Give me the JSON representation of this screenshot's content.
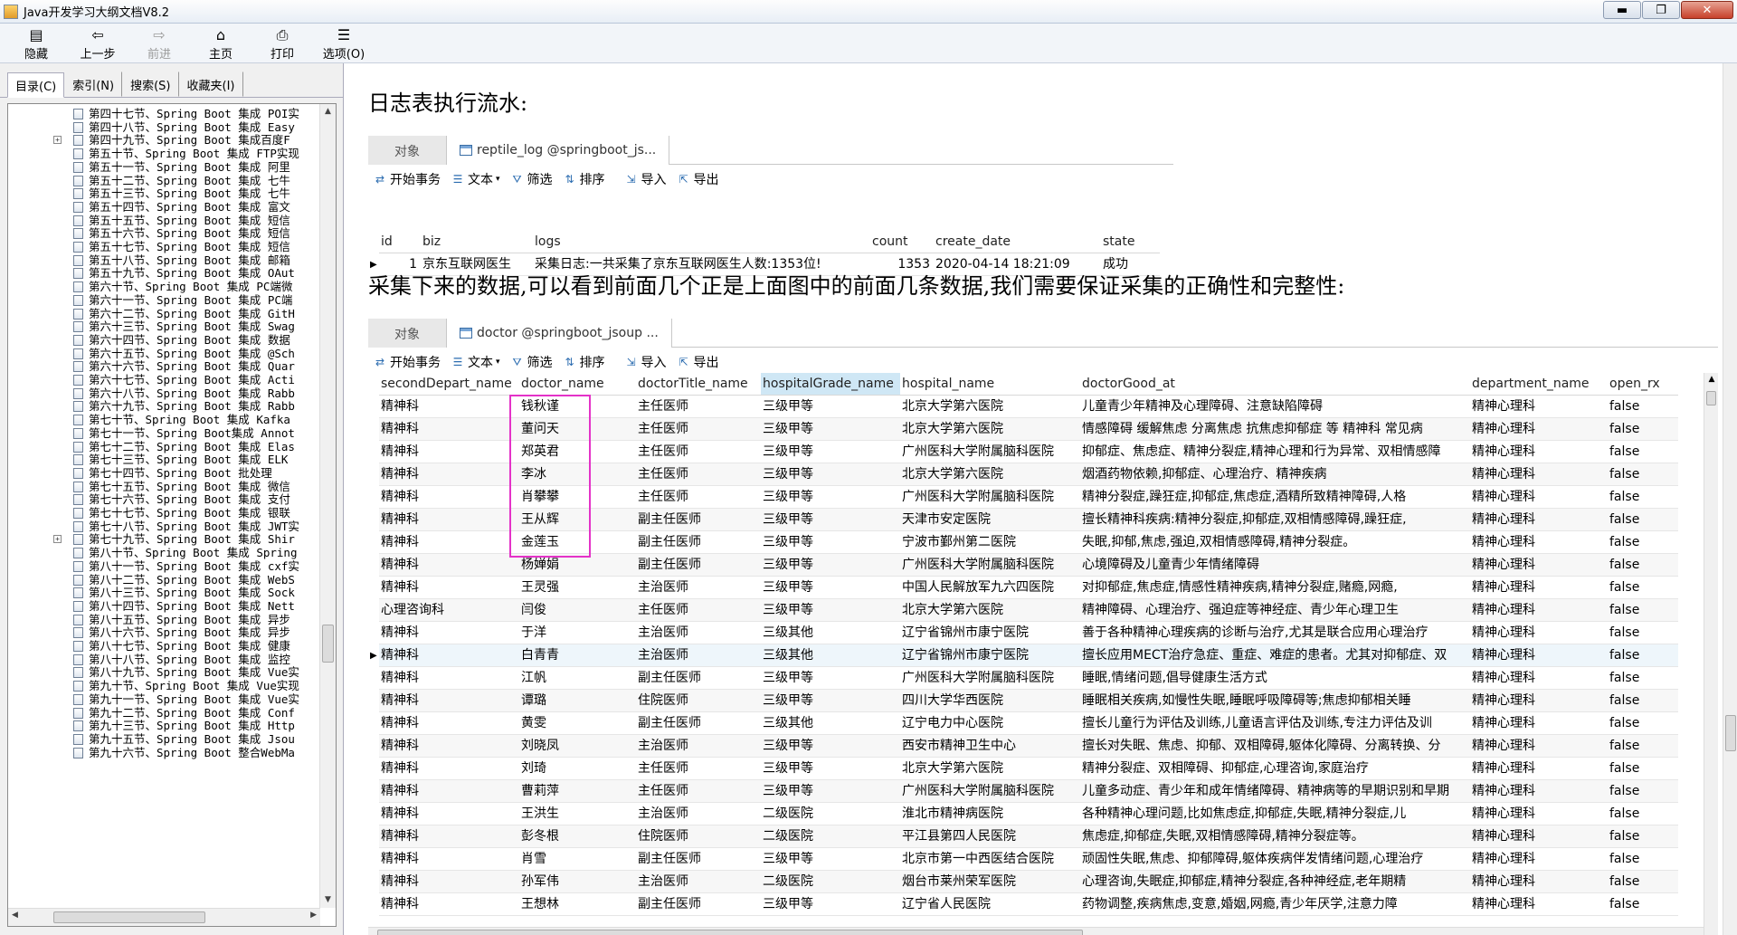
{
  "window": {
    "title": "Java开发学习大纲文档V8.2",
    "buttons": {
      "minimize": "▬",
      "maximize": "❐",
      "close": "✕"
    }
  },
  "toolbar": [
    {
      "icon": "hide-icon",
      "glyph": "▤",
      "label": "隐藏",
      "enabled": true
    },
    {
      "icon": "back-icon",
      "glyph": "⇦",
      "label": "上一步",
      "enabled": true
    },
    {
      "icon": "forward-icon",
      "glyph": "⇨",
      "label": "前进",
      "enabled": false
    },
    {
      "icon": "home-icon",
      "glyph": "⌂",
      "label": "主页",
      "enabled": true
    },
    {
      "icon": "print-icon",
      "glyph": "⎙",
      "label": "打印",
      "enabled": true
    },
    {
      "icon": "options-icon",
      "glyph": "☰",
      "label": "选项(O)",
      "enabled": true
    }
  ],
  "left_tabs": [
    "目录(C)",
    "索引(N)",
    "搜索(S)",
    "收藏夹(I)"
  ],
  "tree_items": [
    {
      "text": "第四十七节、Spring Boot 集成 POI实",
      "plus": false
    },
    {
      "text": "第四十八节、Spring Boot 集成 Easy",
      "plus": false
    },
    {
      "text": "第四十九节、Spring Boot 集成百度F",
      "plus": true
    },
    {
      "text": "第五十节、Spring Boot 集成 FTP实现",
      "plus": false
    },
    {
      "text": "第五十一节、Spring Boot 集成 阿里",
      "plus": false
    },
    {
      "text": "第五十二节、Spring Boot 集成 七牛",
      "plus": false
    },
    {
      "text": "第五十三节、Spring Boot 集成 七牛",
      "plus": false
    },
    {
      "text": "第五十四节、Spring Boot 集成 富文",
      "plus": false
    },
    {
      "text": "第五十五节、Spring Boot 集成 短信",
      "plus": false
    },
    {
      "text": "第五十六节、Spring Boot 集成 短信",
      "plus": false
    },
    {
      "text": "第五十七节、Spring Boot 集成 短信",
      "plus": false
    },
    {
      "text": "第五十八节、Spring Boot 集成 邮箱",
      "plus": false
    },
    {
      "text": "第五十九节、Spring Boot 集成 OAut",
      "plus": false
    },
    {
      "text": "第六十节、Spring Boot 集成 PC端微",
      "plus": false
    },
    {
      "text": "第六十一节、Spring Boot 集成 PC端",
      "plus": false
    },
    {
      "text": "第六十二节、Spring Boot 集成 GitH",
      "plus": false
    },
    {
      "text": "第六十三节、Spring Boot 集成 Swag",
      "plus": false
    },
    {
      "text": "第六十四节、Spring Boot 集成 数据",
      "plus": false
    },
    {
      "text": "第六十五节、Spring Boot 集成 @Sch",
      "plus": false
    },
    {
      "text": "第六十六节、Spring Boot 集成 Quar",
      "plus": false
    },
    {
      "text": "第六十七节、Spring Boot 集成 Acti",
      "plus": false
    },
    {
      "text": "第六十八节、Spring Boot 集成 Rabb",
      "plus": false
    },
    {
      "text": "第六十九节、Spring Boot 集成 Rabb",
      "plus": false
    },
    {
      "text": "第七十节、Spring Boot 集成 Kafka",
      "plus": false
    },
    {
      "text": "第七十一节、Spring Boot集成 Annot",
      "plus": false
    },
    {
      "text": "第七十二节、Spring Boot 集成 Elas",
      "plus": false
    },
    {
      "text": "第七十三节、Spring Boot 集成 ELK",
      "plus": false
    },
    {
      "text": "第七十四节、Spring Boot 批处理",
      "plus": false
    },
    {
      "text": "第七十五节、Spring Boot 集成 微信",
      "plus": false
    },
    {
      "text": "第七十六节、Spring Boot 集成 支付",
      "plus": false
    },
    {
      "text": "第七十七节、Spring Boot 集成 银联",
      "plus": false
    },
    {
      "text": "第七十八节、Spring Boot 集成 JWT实",
      "plus": false
    },
    {
      "text": "第七十九节、Spring Boot 集成 Shir",
      "plus": true
    },
    {
      "text": "第八十节、Spring Boot 集成 Spring",
      "plus": false
    },
    {
      "text": "第八十一节、Spring Boot 集成 cxf实",
      "plus": false
    },
    {
      "text": "第八十二节、Spring Boot 集成 WebS",
      "plus": false
    },
    {
      "text": "第八十三节、Spring Boot 集成 Sock",
      "plus": false
    },
    {
      "text": "第八十四节、Spring Boot 集成 Nett",
      "plus": false
    },
    {
      "text": "第八十五节、Spring Boot 集成 异步",
      "plus": false
    },
    {
      "text": "第八十六节、Spring Boot 集成 异步",
      "plus": false
    },
    {
      "text": "第八十七节、Spring Boot 集成 健康",
      "plus": false
    },
    {
      "text": "第八十八节、Spring Boot 集成 监控",
      "plus": false
    },
    {
      "text": "第八十九节、Spring Boot 集成 Vue实",
      "plus": false
    },
    {
      "text": "第九十节、Spring Boot 集成 Vue实现",
      "plus": false
    },
    {
      "text": "第九十一节、Spring Boot 集成 Vue实",
      "plus": false
    },
    {
      "text": "第九十二节、Spring Boot 集成 Conf",
      "plus": false
    },
    {
      "text": "第九十三节、Spring Boot 集成 Http",
      "plus": false
    },
    {
      "text": "第九十五节、Spring Boot 集成 Jsou",
      "plus": false
    },
    {
      "text": "第九十六节、Spring Boot 整合WebMa",
      "plus": false
    }
  ],
  "content": {
    "heading1": "日志表执行流水:",
    "heading2": "采集下来的数据,可以看到前面几个正是上面图中的前面几条数据,我们需要保证采集的正确性和完整性:",
    "panel1": {
      "obj_tab": "对象",
      "table_tab": "reptile_log @springboot_js...",
      "tools": [
        "开始事务",
        "文本",
        "筛选",
        "排序",
        "导入",
        "导出"
      ],
      "columns": [
        "id",
        "biz",
        "logs",
        "count",
        "create_date",
        "state"
      ],
      "rows": [
        [
          "1",
          "京东互联网医生",
          "采集日志:一共采集了京东互联网医生人数:1353位!",
          "1353",
          "2020-04-14 18:21:09",
          "成功"
        ]
      ]
    },
    "panel2": {
      "obj_tab": "对象",
      "table_tab": "doctor @springboot_jsoup ...",
      "tools": [
        "开始事务",
        "文本",
        "筛选",
        "排序",
        "导入",
        "导出"
      ],
      "columns": [
        "secondDepart_name",
        "doctor_name",
        "doctorTitle_name",
        "hospitalGrade_name",
        "hospital_name",
        "doctorGood_at",
        "department_name",
        "open_rx"
      ],
      "rows": [
        [
          "精神科",
          "钱秋谨",
          "主任医师",
          "三级甲等",
          "北京大学第六医院",
          "儿童青少年精神及心理障碍、注意缺陷障碍",
          "精神心理科",
          "false"
        ],
        [
          "精神科",
          "董问天",
          "主任医师",
          "三级甲等",
          "北京大学第六医院",
          "情感障碍 缓解焦虑 分离焦虑 抗焦虑抑郁症 等 精神科 常见病",
          "精神心理科",
          "false"
        ],
        [
          "精神科",
          "郑英君",
          "主任医师",
          "三级甲等",
          "广州医科大学附属脑科医院",
          "抑郁症、焦虑症、精神分裂症,精神心理和行为异常、双相情感障",
          "精神心理科",
          "false"
        ],
        [
          "精神科",
          "李冰",
          "主任医师",
          "三级甲等",
          "北京大学第六医院",
          "烟酒药物依赖,抑郁症、心理治疗、精神疾病",
          "精神心理科",
          "false"
        ],
        [
          "精神科",
          "肖攀攀",
          "主任医师",
          "三级甲等",
          "广州医科大学附属脑科医院",
          "精神分裂症,躁狂症,抑郁症,焦虑症,酒精所致精神障碍,人格",
          "精神心理科",
          "false"
        ],
        [
          "精神科",
          "王从辉",
          "副主任医师",
          "三级甲等",
          "天津市安定医院",
          "擅长精神科疾病:精神分裂症,抑郁症,双相情感障碍,躁狂症,",
          "精神心理科",
          "false"
        ],
        [
          "精神科",
          "金莲玉",
          "副主任医师",
          "三级甲等",
          "宁波市鄞州第二医院",
          "失眠,抑郁,焦虑,强迫,双相情感障碍,精神分裂症。",
          "精神心理科",
          "false"
        ],
        [
          "精神科",
          "杨婵娟",
          "副主任医师",
          "三级甲等",
          "广州医科大学附属脑科医院",
          "心境障碍及儿童青少年情绪障碍",
          "精神心理科",
          "false"
        ],
        [
          "精神科",
          "王灵强",
          "主治医师",
          "三级甲等",
          "中国人民解放军九六四医院",
          "对抑郁症,焦虑症,情感性精神疾病,精神分裂症,赌瘾,网瘾,",
          "精神心理科",
          "false"
        ],
        [
          "心理咨询科",
          "闫俊",
          "主任医师",
          "三级甲等",
          "北京大学第六医院",
          "精神障碍、心理治疗、强迫症等神经症、青少年心理卫生",
          "精神心理科",
          "false"
        ],
        [
          "精神科",
          "于洋",
          "主治医师",
          "三级其他",
          "辽宁省锦州市康宁医院",
          "善于各种精神心理疾病的诊断与治疗,尤其是联合应用心理治疗",
          "精神心理科",
          "false"
        ],
        [
          "精神科",
          "白青青",
          "主治医师",
          "三级其他",
          "辽宁省锦州市康宁医院",
          "擅长应用MECT治疗急症、重症、难症的患者。尤其对抑郁症、双",
          "精神心理科",
          "false"
        ],
        [
          "精神科",
          "江帆",
          "副主任医师",
          "三级甲等",
          "广州医科大学附属脑科医院",
          "睡眠,情绪问题,倡导健康生活方式",
          "精神心理科",
          "false"
        ],
        [
          "精神科",
          "谭璐",
          "住院医师",
          "三级甲等",
          "四川大学华西医院",
          "睡眠相关疾病,如慢性失眠,睡眠呼吸障碍等;焦虑抑郁相关睡",
          "精神心理科",
          "false"
        ],
        [
          "精神科",
          "黄雯",
          "副主任医师",
          "三级其他",
          "辽宁电力中心医院",
          "擅长儿童行为评估及训练,儿童语言评估及训练,专注力评估及训",
          "精神心理科",
          "false"
        ],
        [
          "精神科",
          "刘晓凤",
          "主治医师",
          "三级甲等",
          "西安市精神卫生中心",
          "擅长对失眠、焦虑、抑郁、双相障碍,躯体化障碍、分离转换、分",
          "精神心理科",
          "false"
        ],
        [
          "精神科",
          "刘琦",
          "主任医师",
          "三级甲等",
          "北京大学第六医院",
          "精神分裂症、双相障碍、抑郁症,心理咨询,家庭治疗",
          "精神心理科",
          "false"
        ],
        [
          "精神科",
          "曹莉萍",
          "主任医师",
          "三级甲等",
          "广州医科大学附属脑科医院",
          "儿童多动症、青少年和成年情绪障碍、精神病等的早期识别和早期",
          "精神心理科",
          "false"
        ],
        [
          "精神科",
          "王洪生",
          "主治医师",
          "二级医院",
          "淮北市精神病医院",
          "各种精神心理问题,比如焦虑症,抑郁症,失眠,精神分裂症,儿",
          "精神心理科",
          "false"
        ],
        [
          "精神科",
          "彭冬根",
          "住院医师",
          "二级医院",
          "平江县第四人民医院",
          "焦虑症,抑郁症,失眠,双相情感障碍,精神分裂症等。",
          "精神心理科",
          "false"
        ],
        [
          "精神科",
          "肖雪",
          "副主任医师",
          "三级甲等",
          "北京市第一中西医结合医院",
          "顽固性失眠,焦虑、抑郁障碍,躯体疾病伴发情绪问题,心理治疗",
          "精神心理科",
          "false"
        ],
        [
          "精神科",
          "孙军伟",
          "主治医师",
          "二级医院",
          "烟台市莱州荣军医院",
          "心理咨询,失眠症,抑郁症,精神分裂症,各种神经症,老年期精",
          "精神心理科",
          "false"
        ],
        [
          "精神科",
          "王想林",
          "副主任医师",
          "三级甲等",
          "辽宁省人民医院",
          "药物调整,疾病焦虑,变意,婚姻,网瘾,青少年厌学,注意力障",
          "精神心理科",
          "false"
        ]
      ]
    }
  }
}
